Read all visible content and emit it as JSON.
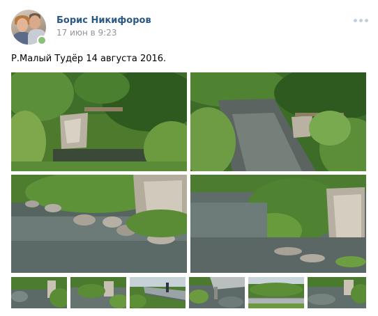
{
  "post": {
    "author_name": "Борис Никифоров",
    "timestamp": "17 июн в 9:23",
    "text": "Р.Малый Тудёр 14 августа 2016."
  },
  "icons": {
    "more": "more-horizontal-icon",
    "online": "online-status-dot"
  },
  "colors": {
    "author_link": "#2a5885",
    "date": "#939393",
    "online": "#8ac176"
  },
  "photos": [
    "photo-1",
    "photo-2",
    "photo-3",
    "photo-4",
    "photo-5",
    "photo-6",
    "photo-7",
    "photo-8",
    "photo-9",
    "photo-10"
  ]
}
